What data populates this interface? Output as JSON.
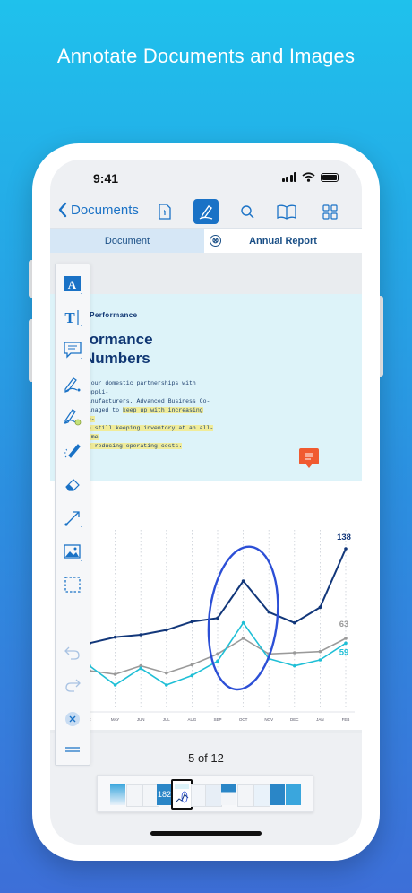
{
  "headline": "Annotate Documents and Images",
  "status": {
    "time": "9:41"
  },
  "navbar": {
    "back_label": "Documents",
    "icons": [
      "document-info-icon",
      "annotate-pen-icon",
      "search-icon",
      "reader-book-icon",
      "grid-icon"
    ],
    "active_icon": "annotate-pen-icon"
  },
  "tabs": {
    "document": "Document",
    "annual_report": "Annual Report",
    "close_glyph": "⊗"
  },
  "document": {
    "kicker": "r Performance",
    "title_line1": "formance",
    "title_line2": "Numbers",
    "body_plain_1": "n our domestic partnerships with suppli-",
    "body_plain_2": "manufacturers, Advanced Business Co-",
    "body_plain_3": "managed to ",
    "body_hl_3": "keep up with increasing de-",
    "body_hl_4": "de still keeping inventory at an all-time",
    "body_hl_5": "er reducing operating costs."
  },
  "toolbar": {
    "tools": [
      "text-box-icon",
      "typewriter-icon",
      "note-comment-icon",
      "freehand-pen-icon",
      "highlighter-pen-icon",
      "smart-pen-icon",
      "eraser-icon",
      "line-arrow-icon",
      "image-stamp-icon",
      "selection-icon",
      "undo-icon",
      "redo-icon",
      "close-toolbar-icon",
      "drag-handle-icon"
    ]
  },
  "colors": {
    "accent": "#1a72c6",
    "series_dark": "#12377a",
    "series_cyan": "#1fbfd6",
    "series_gray": "#9a9a9a",
    "ink_circle": "#2c4fd6",
    "comment": "#f05a30"
  },
  "chart_data": {
    "type": "line",
    "categories": [
      "R",
      "MAY",
      "JUN",
      "JUL",
      "AUG",
      "SEP",
      "OCT",
      "NOV",
      "DEC",
      "JAN",
      "FEB"
    ],
    "series": [
      {
        "values": [
          59,
          64,
          66,
          70,
          77,
          80,
          111,
          85,
          76,
          89,
          138
        ]
      },
      {
        "values": [
          36,
          33,
          40,
          34,
          41,
          50,
          63,
          50,
          51,
          52,
          63
        ]
      },
      {
        "values": [
          40,
          24,
          38,
          24,
          32,
          44,
          76,
          46,
          40,
          45,
          59
        ]
      }
    ],
    "end_labels": [
      "138",
      "63",
      "59"
    ],
    "ylim": [
      0,
      150
    ],
    "grid": "vertical dotted"
  },
  "pager": {
    "text": "5 of 12",
    "current_thumb_label": "182"
  }
}
